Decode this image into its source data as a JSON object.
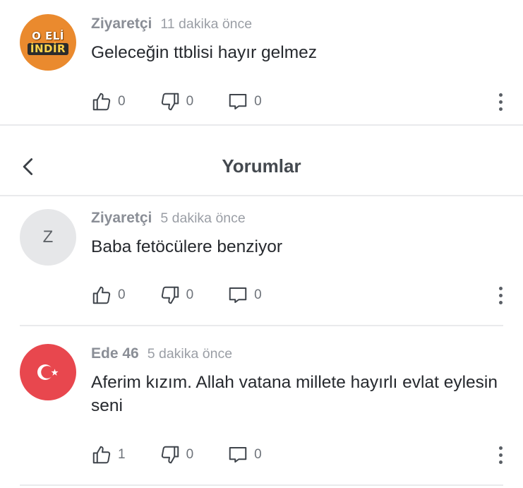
{
  "header": {
    "title": "Yorumlar"
  },
  "comments": [
    {
      "author": "Ziyaretçi",
      "time": "11 dakika önce",
      "text": "Geleceğin ttblisi hayır gelmez",
      "likes": "0",
      "dislikes": "0",
      "replies": "0",
      "avatar": {
        "type": "logo",
        "line1": "O ELİ",
        "line2": "İNDİR"
      }
    },
    {
      "author": "Ziyaretçi",
      "time": "5 dakika önce",
      "text": "Baba fetöcülere benziyor",
      "likes": "0",
      "dislikes": "0",
      "replies": "0",
      "avatar": {
        "type": "letter",
        "letter": "Z"
      }
    },
    {
      "author": "Ede 46",
      "time": "5 dakika önce",
      "text": "Aferim kızım. Allah vatana millete hayırlı evlat eylesin seni",
      "likes": "1",
      "dislikes": "0",
      "replies": "0",
      "avatar": {
        "type": "flag"
      }
    }
  ],
  "icons": {
    "like": "thumbs-up-icon",
    "dislike": "thumbs-down-icon",
    "reply": "comment-bubble-icon",
    "more": "more-vertical-icon",
    "back": "chevron-left-icon"
  },
  "colors": {
    "flag_red": "#e8474e",
    "logo_orange": "#ea8a2e",
    "letter_avatar_bg": "#e6e7e9"
  }
}
